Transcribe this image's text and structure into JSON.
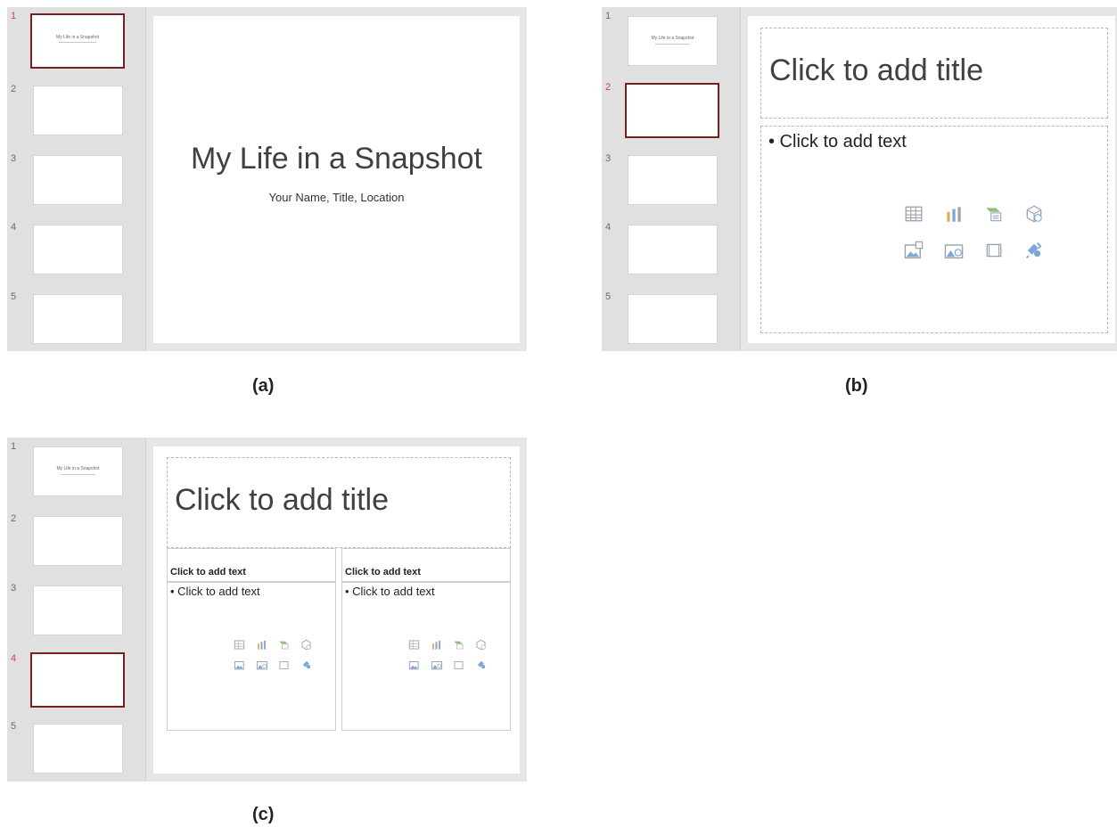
{
  "panels": {
    "a": {
      "caption": "(a)",
      "slides": [
        {
          "num": "1",
          "thumb_title": "My Life in a Snapshot"
        },
        {
          "num": "2"
        },
        {
          "num": "3"
        },
        {
          "num": "4"
        },
        {
          "num": "5"
        }
      ],
      "active_slide": "1",
      "slide": {
        "title": "My Life in a Snapshot",
        "subtitle": "Your Name, Title, Location"
      }
    },
    "b": {
      "caption": "(b)",
      "slides": [
        {
          "num": "1",
          "thumb_title": "My Life in a Snapshot"
        },
        {
          "num": "2"
        },
        {
          "num": "3"
        },
        {
          "num": "4"
        },
        {
          "num": "5"
        }
      ],
      "active_slide": "2",
      "slide": {
        "title_placeholder": "Click to add title",
        "body_placeholder": "• Click to add text"
      }
    },
    "c": {
      "caption": "(c)",
      "slides": [
        {
          "num": "1",
          "thumb_title": "My Life in a Snapshot"
        },
        {
          "num": "2"
        },
        {
          "num": "3"
        },
        {
          "num": "4"
        },
        {
          "num": "5"
        }
      ],
      "active_slide": "4",
      "slide": {
        "title_placeholder": "Click to add title",
        "left_header": "Click to add text",
        "left_body": "• Click to add text",
        "right_header": "Click to add text",
        "right_body": "• Click to add text"
      }
    }
  },
  "content_icons": [
    "table-icon",
    "chart-icon",
    "smartart-icon",
    "3d-model-icon",
    "picture-icon",
    "online-picture-icon",
    "video-icon",
    "icons-icon"
  ],
  "colors": {
    "active_border": "#7b1e1e",
    "active_number": "#c94a34",
    "icon_gray": "#9aa4b0",
    "icon_blue": "#7ea6d6",
    "icon_gold": "#d9b25a"
  }
}
